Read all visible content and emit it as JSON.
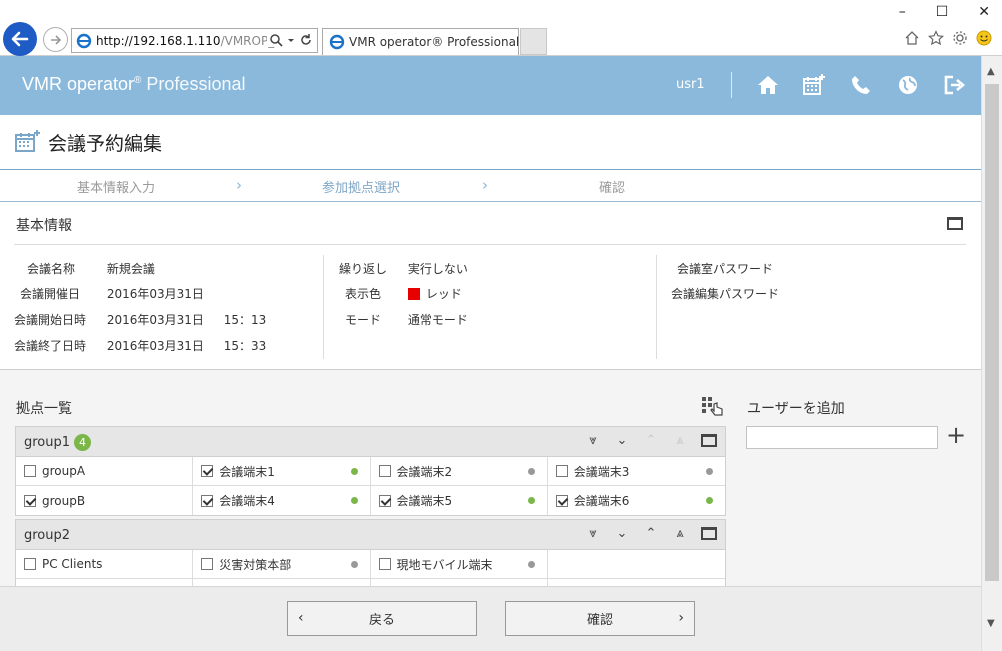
{
  "browser": {
    "address_host": "http://192.168.1.110",
    "address_path": "/VMROP_De",
    "tab_title": "VMR operator® Professional",
    "tab_close": "×",
    "win_min": "–",
    "win_max": "☐",
    "win_close": "✕"
  },
  "header": {
    "brand": "VMR operator",
    "brand_reg": "®",
    "brand_suffix": " Professional",
    "user": "usr1"
  },
  "page": {
    "title": "会議予約編集"
  },
  "stepper": {
    "steps": [
      "基本情報入力",
      "参加拠点選択",
      "確認"
    ],
    "active_index": 1
  },
  "info": {
    "title": "基本情報",
    "col1": [
      {
        "label": "会議名称",
        "value": "新規会議",
        "time": ""
      },
      {
        "label": "会議開催日",
        "value": "2016年03月31日",
        "time": ""
      },
      {
        "label": "会議開始日時",
        "value": "2016年03月31日",
        "time": "15：13"
      },
      {
        "label": "会議終了日時",
        "value": "2016年03月31日",
        "time": "15：33"
      }
    ],
    "col2": [
      {
        "label": "繰り返し",
        "value": "実行しない"
      },
      {
        "label": "表示色",
        "value": "レッド",
        "color": "#e60000"
      },
      {
        "label": "モード",
        "value": "通常モード"
      }
    ],
    "col3": [
      {
        "label": "会議室パスワード"
      },
      {
        "label": "会議編集パスワード"
      }
    ]
  },
  "sites": {
    "title": "拠点一覧",
    "groups": [
      {
        "name": "group1",
        "badge": "4",
        "rows": [
          [
            {
              "label": "groupA",
              "checked": false,
              "status": ""
            },
            {
              "label": "会議端末1",
              "checked": true,
              "status": "online"
            },
            {
              "label": "会議端末2",
              "checked": false,
              "status": "offline"
            },
            {
              "label": "会議端末3",
              "checked": false,
              "status": "offline"
            }
          ],
          [
            {
              "label": "groupB",
              "checked": true,
              "status": ""
            },
            {
              "label": "会議端末4",
              "checked": true,
              "status": "online"
            },
            {
              "label": "会議端末5",
              "checked": true,
              "status": "online"
            },
            {
              "label": "会議端末6",
              "checked": true,
              "status": "online"
            }
          ]
        ]
      },
      {
        "name": "group2",
        "badge": "",
        "rows": [
          [
            {
              "label": "PC Clients",
              "checked": false,
              "status": ""
            },
            {
              "label": "災害対策本部",
              "checked": false,
              "status": "offline"
            },
            {
              "label": "現地モバイル端末",
              "checked": false,
              "status": "offline"
            },
            {
              "label": "",
              "checked": null,
              "status": ""
            }
          ]
        ]
      }
    ]
  },
  "add_user": {
    "title": "ユーザーを追加",
    "value": "",
    "plus": "+"
  },
  "footer": {
    "back_label": "戻る",
    "confirm_label": "確認"
  },
  "colors": {
    "header_bg": "#8bb9dc",
    "online": "#7ab648",
    "offline": "#999999",
    "accent_step": "#7fa7c6"
  }
}
